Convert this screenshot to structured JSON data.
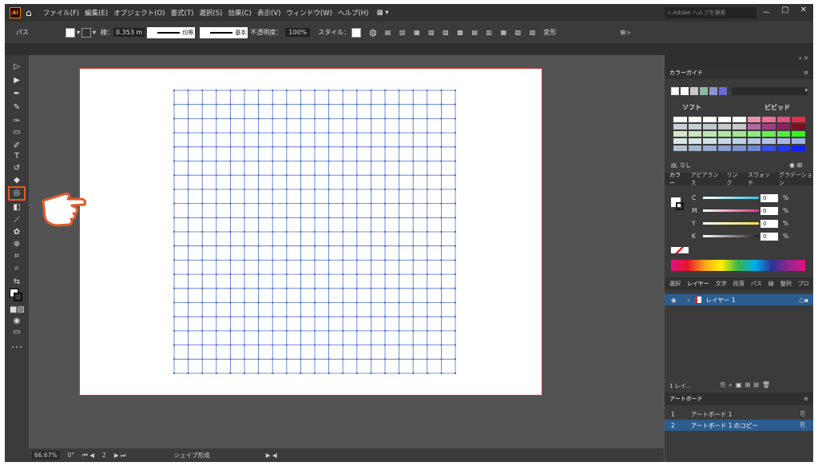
{
  "app": {
    "logo": "Ai",
    "home_icon": "home-icon"
  },
  "menu": [
    "ファイル(F)",
    "編集(E)",
    "オブジェクト(O)",
    "書式(T)",
    "選択(S)",
    "効果(C)",
    "表示(V)",
    "ウィンドウ(W)",
    "ヘルプ(H)"
  ],
  "search": {
    "placeholder": "Adobe ヘルプを検索"
  },
  "window_controls": [
    "－",
    "▢",
    "✕"
  ],
  "control_bar": {
    "selection_label": "パス",
    "stroke_label": "線：",
    "stroke_weight": "0.353 m",
    "profile": "均等",
    "brush": "基本",
    "opacity_label": "不透明度：",
    "opacity_value": "100%",
    "style_label": "スタイル：",
    "shape_label": "変形"
  },
  "tools": {
    "highlighted": "shape-builder-tool",
    "more": "･･･"
  },
  "status": {
    "zoom": "66.67%",
    "rotation": "0°",
    "artboard_num": "2",
    "tool_name": "シェイプ形成"
  },
  "color_guide": {
    "tab": "カラーガイド",
    "left_label": "ソフト",
    "right_label": "ビビッド",
    "none_label": "なし",
    "swatches": [
      [
        "#ffffff",
        "#ffffff",
        "#ffffff",
        "#ffffff",
        "#ffffff",
        "#f08fb4",
        "#ee6e98",
        "#e94e7a",
        "#e32b45"
      ],
      [
        "#c9cfd4",
        "#c6cfd4",
        "#c0c8cc",
        "#c4c9c9",
        "#c9c9c9",
        "#b06aa0",
        "#a04080",
        "#8d2060",
        "#7a1020"
      ],
      [
        "#d4e6c8",
        "#c9e6bd",
        "#bfe6b2",
        "#b2e6a3",
        "#a3e693",
        "#8dea7c",
        "#6ded50",
        "#55ef3a",
        "#36f41e"
      ],
      [
        "#dce6e6",
        "#d8e6e6",
        "#d0e0e6",
        "#c8d8e6",
        "#c0d0e6",
        "#bac8e6",
        "#b0c0e6",
        "#a8b8e6",
        "#9eb0e6"
      ],
      [
        "#b5c0cf",
        "#a6b5cf",
        "#98aacf",
        "#8a9ecf",
        "#7d93cf",
        "#6e88cf",
        "#3a4fe6",
        "#2636ef",
        "#1020f5"
      ]
    ]
  },
  "color_panel": {
    "tabs": [
      "カラー",
      "アピアランス",
      "リンク",
      "スウォッチ",
      "グラデーション"
    ],
    "channels": [
      {
        "name": "C",
        "value": "0",
        "unit": "%",
        "color": "#2fc3e8"
      },
      {
        "name": "M",
        "value": "0",
        "unit": "%",
        "color": "#e0337f"
      },
      {
        "name": "Y",
        "value": "0",
        "unit": "%",
        "color": "#f1e24a"
      },
      {
        "name": "K",
        "value": "0",
        "unit": "%",
        "color": "#222222"
      }
    ]
  },
  "layers_panel": {
    "tabs": [
      "選択",
      "レイヤー",
      "文字",
      "段落",
      "パス",
      "線",
      "整列",
      "プロ"
    ],
    "layers": [
      {
        "name": "レイヤー 1"
      }
    ],
    "count": "1 レイ…"
  },
  "artboards_panel": {
    "tab": "アートボード",
    "items": [
      {
        "num": "1",
        "name": "アートボード 1"
      },
      {
        "num": "2",
        "name": "アートボード 1 のコピー"
      }
    ]
  },
  "colors": {
    "accent": "#e05a2b",
    "grid": "#4a6fd0",
    "selection": "#2c5d8f"
  }
}
